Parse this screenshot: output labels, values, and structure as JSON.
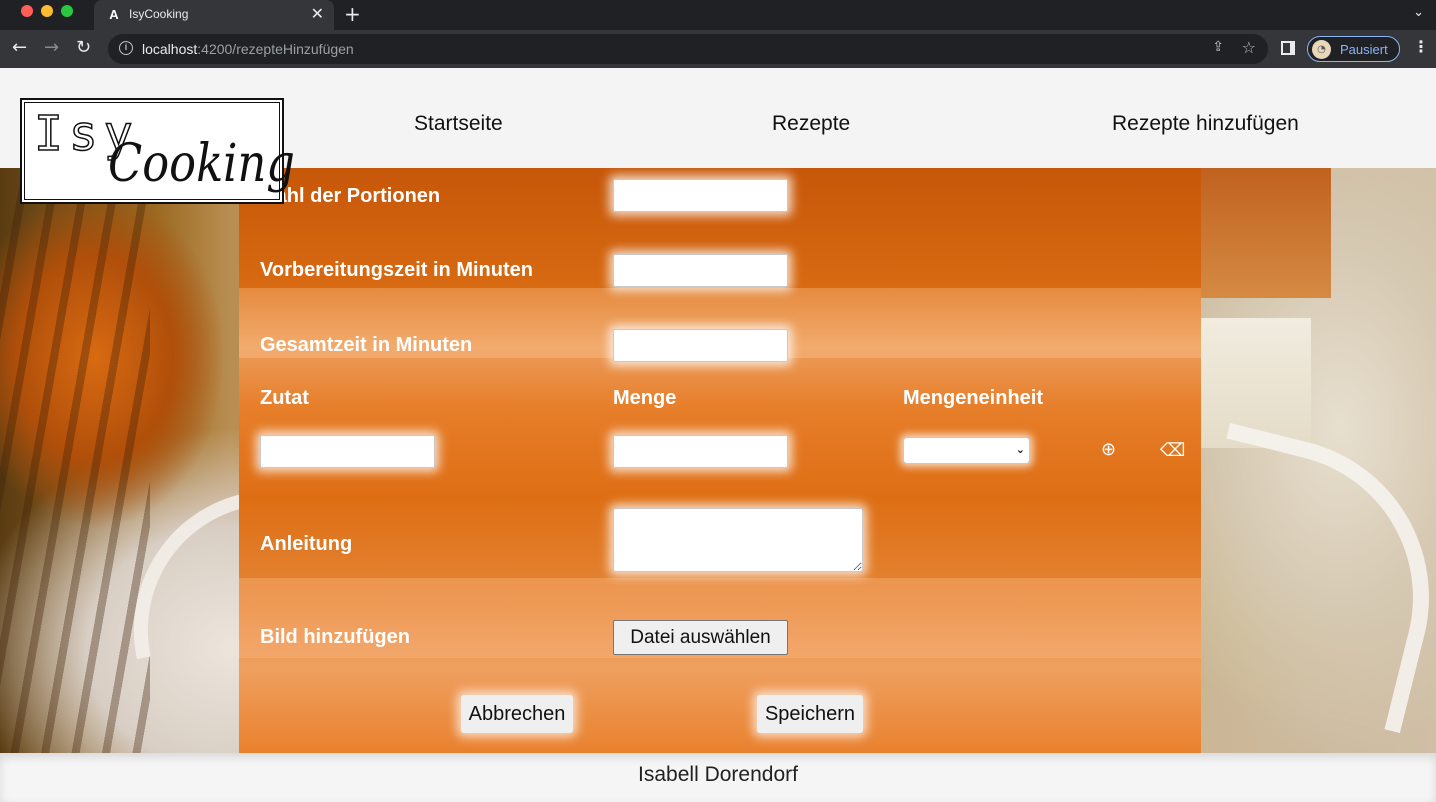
{
  "browser": {
    "tab_favicon": "A",
    "tab_title": "IsyCooking",
    "tab_close": "✕",
    "new_tab": "+",
    "tab_menu": "⌄",
    "url_host": "localhost",
    "url_path": ":4200/rezepteHinzufügen",
    "profile_label": "Pausiert",
    "icons": {
      "back": "←",
      "forward": "→",
      "reload": "↻",
      "info": "i",
      "share": "⇪",
      "star": "☆",
      "menu": "⋮",
      "avatar": "◔"
    }
  },
  "header": {
    "logo_top": "Isy",
    "logo_bottom": "Cooking",
    "nav": {
      "home": "Startseite",
      "recipes": "Rezepte",
      "add_recipes": "Rezepte hinzufügen"
    }
  },
  "form": {
    "portions_label": "Anzahl der Portionen",
    "prep_time_label": "Vorbereitungszeit in Minuten",
    "total_time_label": "Gesamtzeit in Minuten",
    "ingredient_label": "Zutat",
    "amount_label": "Menge",
    "unit_label": "Mengeneinheit",
    "unit_selected": "",
    "add_icon": "⊕",
    "erase_icon": "⌫",
    "instructions_label": "Anleitung",
    "image_label": "Bild hinzufügen",
    "file_button": "Datei auswählen",
    "cancel_button": "Abbrechen",
    "save_button": "Speichern"
  },
  "footer": {
    "author": "Isabell Dorendorf"
  }
}
